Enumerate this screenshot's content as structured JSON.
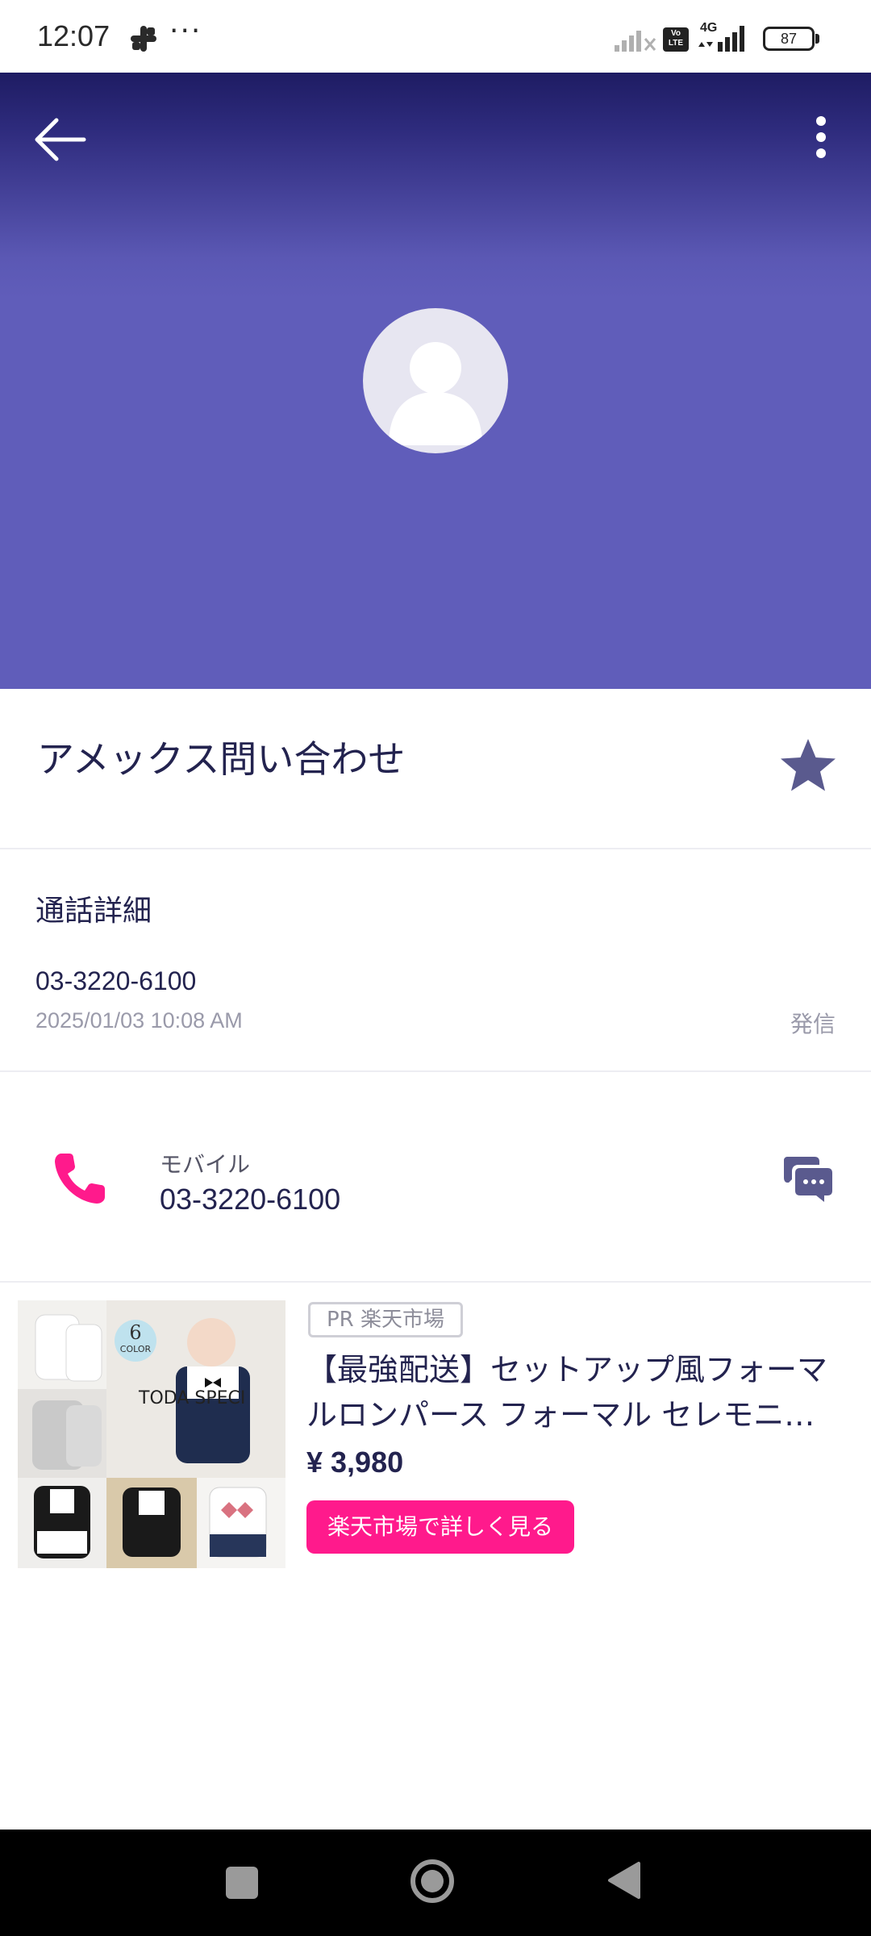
{
  "status_bar": {
    "time": "12:07",
    "dots": "···",
    "volte": "Vo LTE",
    "network": "4G",
    "battery": "87"
  },
  "contact": {
    "name": "アメックス問い合わせ"
  },
  "call_detail": {
    "title": "通話詳細",
    "number": "03-3220-6100",
    "timestamp": "2025/01/03 10:08 AM",
    "type": "発信"
  },
  "phone": {
    "label": "モバイル",
    "number": "03-3220-6100"
  },
  "ad": {
    "badge": "PR 楽天市場",
    "title": "【最強配送】セットアップ風フォーマルロンパース フォーマル セレモニ…",
    "price": "¥ 3,980",
    "cta": "楽天市場で詳しく見る",
    "image_tag": "6 COLOR",
    "image_tag_num": "6",
    "image_tag_word": "COLOR",
    "image_text": "TODA SPECI"
  },
  "colors": {
    "header_top": "#1e1c63",
    "header_main": "#605dba",
    "accent_pink": "#ff1a8c",
    "star": "#5a5a8e",
    "text_dark": "#23234f"
  }
}
